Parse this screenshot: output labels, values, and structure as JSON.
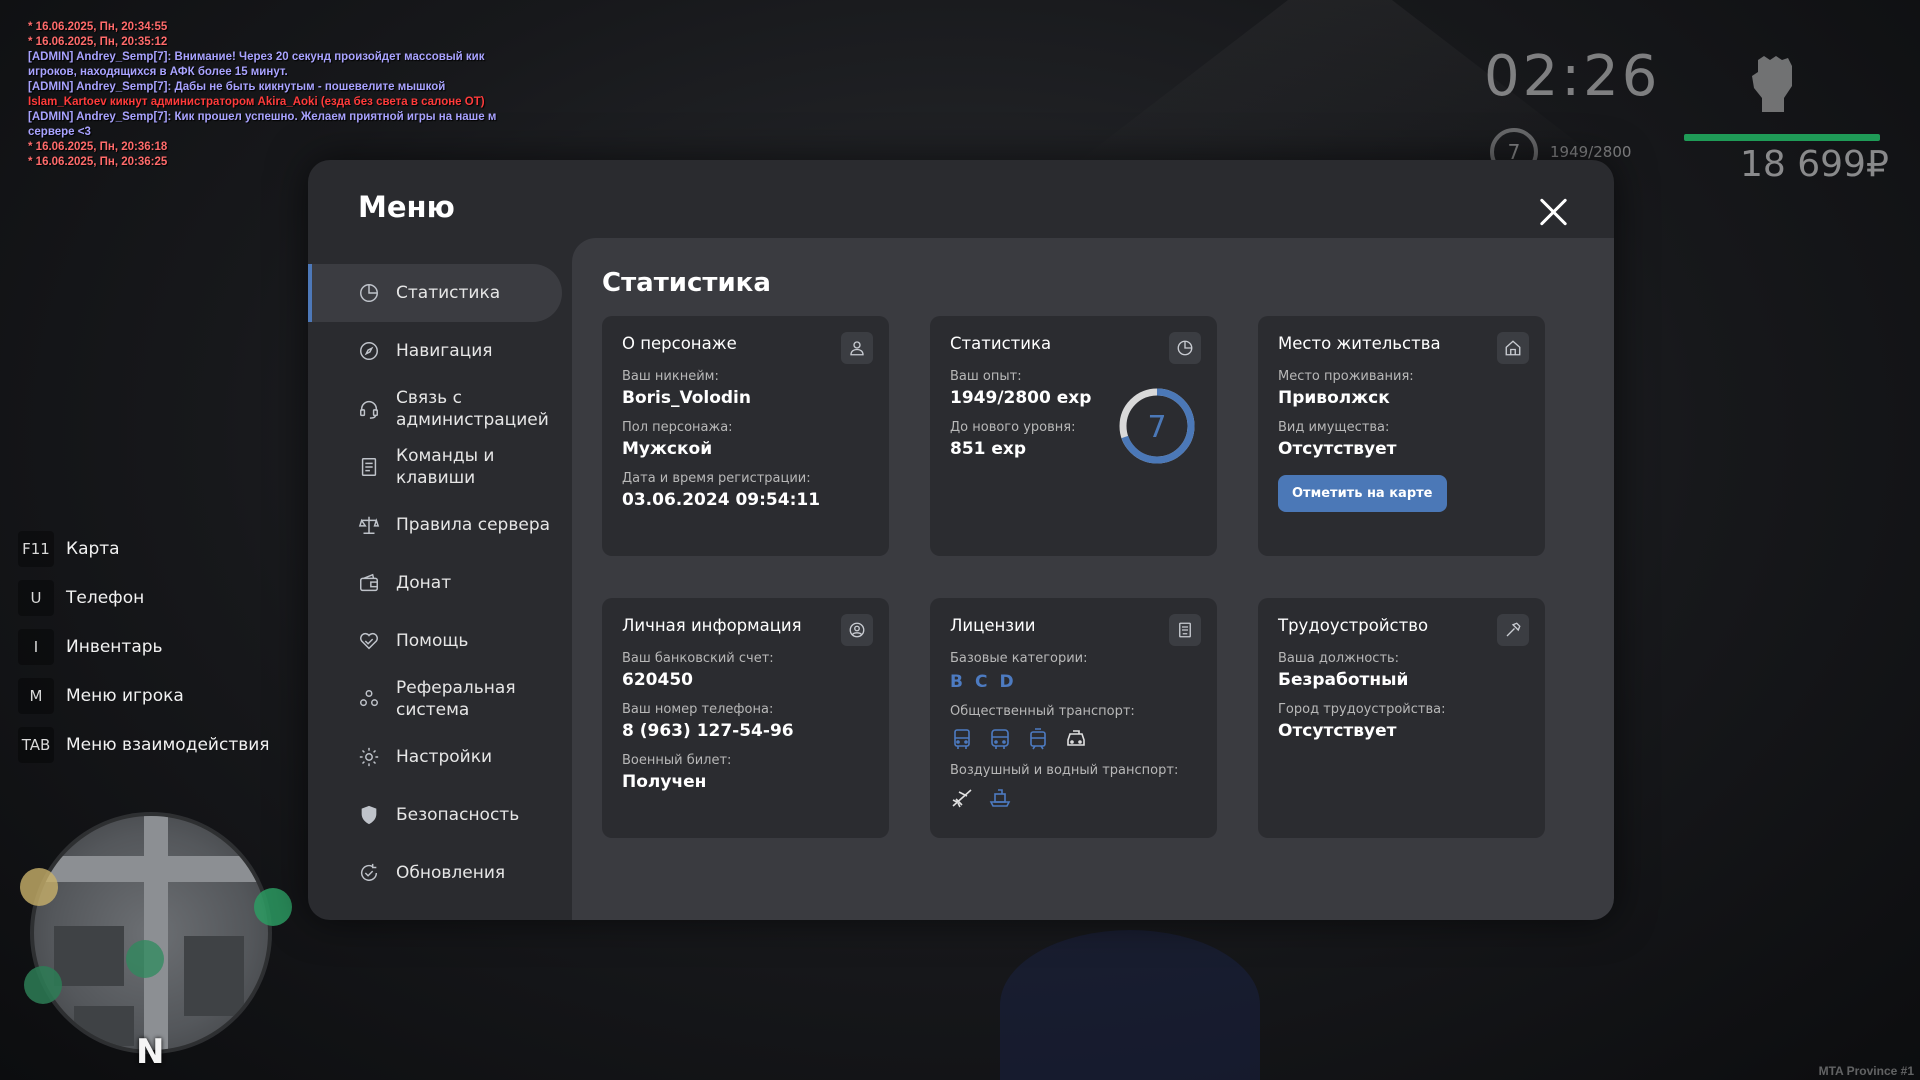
{
  "chat": [
    {
      "type": "system",
      "text": "* 16.06.2025, Пн, 20:34:55"
    },
    {
      "type": "system",
      "text": "* 16.06.2025, Пн, 20:35:12"
    },
    {
      "type": "admin",
      "text": "[ADMIN] Andrey_Semp[7]: Внимание! Через 20 секунд произойдет массовый кик игроков, находящихся в АФК более 15 минут."
    },
    {
      "type": "admin",
      "text": "[ADMIN] Andrey_Semp[7]: Дабы не быть кикнутым - пошевелите мышкой"
    },
    {
      "type": "kick",
      "text": "Islam_Kartoev кикнут администратором Akira_Aoki (езда без света в салоне ОТ)"
    },
    {
      "type": "admin",
      "text": "[ADMIN] Andrey_Semp[7]: Кик прошел успешно. Желаем приятной игры на наше м сервере <3"
    },
    {
      "type": "system",
      "text": "* 16.06.2025, Пн, 20:36:18"
    },
    {
      "type": "system",
      "text": "* 16.06.2025, Пн, 20:36:25"
    }
  ],
  "hud": {
    "clock": "02:26",
    "level": "7",
    "exp": "1949/2800",
    "health_fraction": 1.0,
    "money": "18 699₽"
  },
  "hotkeys": [
    {
      "key": "F11",
      "label": "Карта"
    },
    {
      "key": "U",
      "label": "Телефон"
    },
    {
      "key": "I",
      "label": "Инвентарь"
    },
    {
      "key": "M",
      "label": "Меню игрока"
    },
    {
      "key": "TAB",
      "label": "Меню взаимодействия"
    }
  ],
  "minimap": {
    "north": "N"
  },
  "watermark": "MTA Province #1",
  "menu": {
    "title": "Меню",
    "nav": [
      {
        "label": "Статистика",
        "icon": "pie-chart-icon",
        "active": true
      },
      {
        "label": "Навигация",
        "icon": "compass-icon"
      },
      {
        "label": "Связь с администрацией",
        "icon": "headset-icon"
      },
      {
        "label": "Команды и клавиши",
        "icon": "document-icon"
      },
      {
        "label": "Правила сервера",
        "icon": "scales-icon"
      },
      {
        "label": "Донат",
        "icon": "wallet-icon"
      },
      {
        "label": "Помощь",
        "icon": "heart-hand-icon"
      },
      {
        "label": "Реферальная система",
        "icon": "people-icon"
      },
      {
        "label": "Настройки",
        "icon": "gear-icon"
      },
      {
        "label": "Безопасность",
        "icon": "shield-icon"
      },
      {
        "label": "Обновления",
        "icon": "refresh-check-icon"
      }
    ],
    "section_title": "Статистика",
    "cards": {
      "character": {
        "title": "О персонаже",
        "nickname_label": "Ваш никнейм:",
        "nickname": "Boris_Volodin",
        "gender_label": "Пол персонажа:",
        "gender": "Мужской",
        "reg_label": "Дата и время регистрации:",
        "reg": "03.06.2024 09:54:11"
      },
      "stats": {
        "title": "Статистика",
        "exp_label": "Ваш опыт:",
        "exp": "1949/2800 exp",
        "next_label": "До нового уровня:",
        "next": "851 exp",
        "level": "7",
        "progress": 0.696
      },
      "residence": {
        "title": "Место жительства",
        "place_label": "Место проживания:",
        "place": "Приволжск",
        "property_label": "Вид имущества:",
        "property": "Отсутствует",
        "button": "Отметить на карте"
      },
      "personal": {
        "title": "Личная информация",
        "bank_label": "Ваш банковский счет:",
        "bank": "620450",
        "phone_label": "Ваш номер телефона:",
        "phone": "8 (963) 127-54-96",
        "military_label": "Военный билет:",
        "military": "Получен"
      },
      "licenses": {
        "title": "Лицензии",
        "base_label": "Базовые категории:",
        "categories": [
          "B",
          "C",
          "D"
        ],
        "public_label": "Общественный транспорт:",
        "public_icons": [
          "bus-icon",
          "bus-icon",
          "tram-icon",
          "taxi-icon"
        ],
        "air_label": "Воздушный и водный транспорт:",
        "air_icons": [
          "plane-icon",
          "ship-icon"
        ]
      },
      "employment": {
        "title": "Трудоустройство",
        "position_label": "Ваша должность:",
        "position": "Безработный",
        "city_label": "Город трудоустройства:",
        "city": "Отсутствует"
      }
    }
  },
  "colors": {
    "accent": "#4b78b7",
    "panel": "#2a2b2f",
    "content": "#3a3b40",
    "card": "#2b2c30",
    "health": "#1f9b57"
  }
}
